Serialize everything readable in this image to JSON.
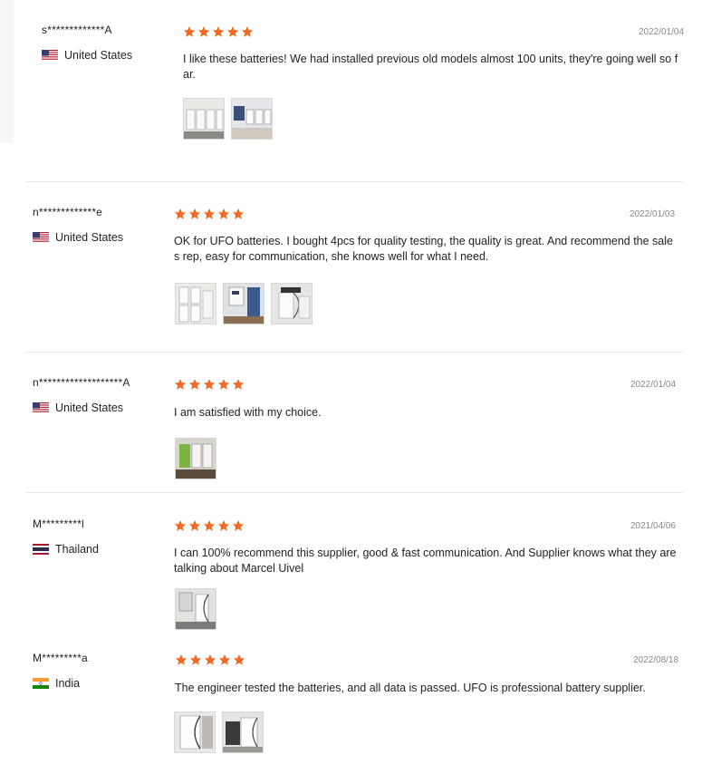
{
  "reviews": [
    {
      "user": "s*************A",
      "country": "United States",
      "flag": "us-flag-icon",
      "rating": 5,
      "date": "2022/01/04",
      "text": "I like these batteries! We had installed previous old models almost 100 units, they're going well so far.",
      "thumbnails": 2
    },
    {
      "user": "n*************e",
      "country": "United States",
      "flag": "us-flag-icon",
      "rating": 5,
      "date": "2022/01/03",
      "text": "OK for UFO batteries. I bought 4pcs for quality testing, the quality is great. And recommend the sales rep, easy for communication, she knows well for what I need.",
      "thumbnails": 3
    },
    {
      "user": "n*******************A",
      "country": "United States",
      "flag": "us-flag-icon",
      "rating": 5,
      "date": "2022/01/04",
      "text": "I am satisfied with my choice.",
      "thumbnails": 1
    },
    {
      "user": "M*********l",
      "country": "Thailand",
      "flag": "thailand-flag-icon",
      "rating": 5,
      "date": "2021/04/06",
      "text": "I can 100% recommend this supplier, good & fast communication. And Supplier knows what they are talking about Marcel Uivel",
      "thumbnails": 1
    },
    {
      "user": "M*********a",
      "country": "India",
      "flag": "india-flag-icon",
      "rating": 5,
      "date": "2022/08/18",
      "text": "The engineer tested the batteries, and all data is passed. UFO is professional battery supplier.",
      "thumbnails": 2
    }
  ],
  "colors": {
    "star": "#f06a23",
    "date": "#888888",
    "divider": "#e8e8e8",
    "text": "#222222"
  }
}
